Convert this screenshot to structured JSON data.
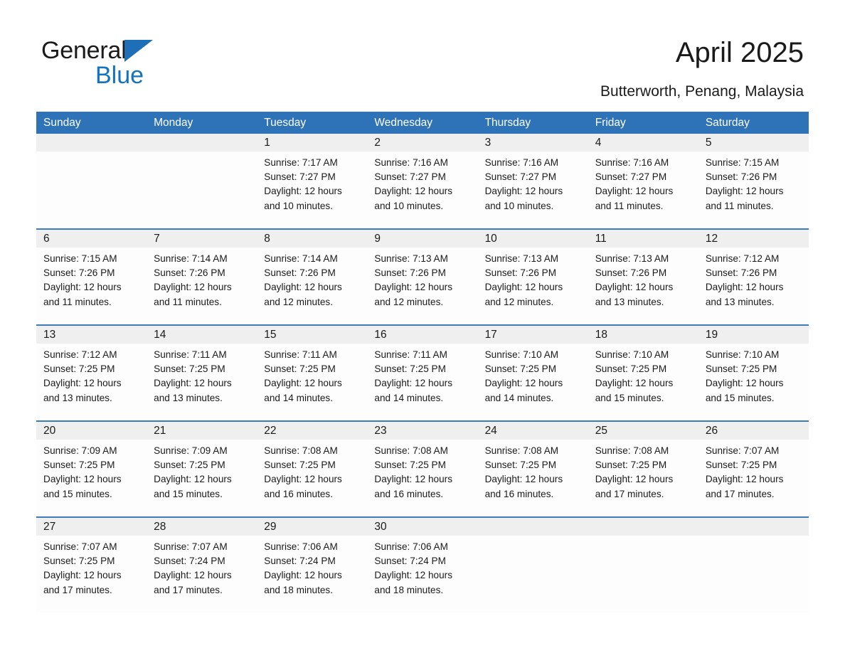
{
  "brand": {
    "name_part1": "General",
    "name_part2": "Blue",
    "triangle_color": "#1e6fb8",
    "blue_color": "#1273c4"
  },
  "header": {
    "title": "April 2025",
    "subtitle": "Butterworth, Penang, Malaysia"
  },
  "colors": {
    "header_blue": "#2e73b8",
    "row_divider_blue": "#3d7cb5",
    "date_strip_gray": "#efefef",
    "cell_background": "#fdfdfd",
    "text": "#1a1a1a"
  },
  "calendar": {
    "weekday_headers": [
      "Sunday",
      "Monday",
      "Tuesday",
      "Wednesday",
      "Thursday",
      "Friday",
      "Saturday"
    ],
    "weeks": [
      {
        "days": [
          {
            "date": "",
            "empty": true
          },
          {
            "date": "",
            "empty": true
          },
          {
            "date": "1",
            "sunrise": "Sunrise: 7:17 AM",
            "sunset": "Sunset: 7:27 PM",
            "daylight_1": "Daylight: 12 hours",
            "daylight_2": "and 10 minutes."
          },
          {
            "date": "2",
            "sunrise": "Sunrise: 7:16 AM",
            "sunset": "Sunset: 7:27 PM",
            "daylight_1": "Daylight: 12 hours",
            "daylight_2": "and 10 minutes."
          },
          {
            "date": "3",
            "sunrise": "Sunrise: 7:16 AM",
            "sunset": "Sunset: 7:27 PM",
            "daylight_1": "Daylight: 12 hours",
            "daylight_2": "and 10 minutes."
          },
          {
            "date": "4",
            "sunrise": "Sunrise: 7:16 AM",
            "sunset": "Sunset: 7:27 PM",
            "daylight_1": "Daylight: 12 hours",
            "daylight_2": "and 11 minutes."
          },
          {
            "date": "5",
            "sunrise": "Sunrise: 7:15 AM",
            "sunset": "Sunset: 7:26 PM",
            "daylight_1": "Daylight: 12 hours",
            "daylight_2": "and 11 minutes."
          }
        ]
      },
      {
        "days": [
          {
            "date": "6",
            "sunrise": "Sunrise: 7:15 AM",
            "sunset": "Sunset: 7:26 PM",
            "daylight_1": "Daylight: 12 hours",
            "daylight_2": "and 11 minutes."
          },
          {
            "date": "7",
            "sunrise": "Sunrise: 7:14 AM",
            "sunset": "Sunset: 7:26 PM",
            "daylight_1": "Daylight: 12 hours",
            "daylight_2": "and 11 minutes."
          },
          {
            "date": "8",
            "sunrise": "Sunrise: 7:14 AM",
            "sunset": "Sunset: 7:26 PM",
            "daylight_1": "Daylight: 12 hours",
            "daylight_2": "and 12 minutes."
          },
          {
            "date": "9",
            "sunrise": "Sunrise: 7:13 AM",
            "sunset": "Sunset: 7:26 PM",
            "daylight_1": "Daylight: 12 hours",
            "daylight_2": "and 12 minutes."
          },
          {
            "date": "10",
            "sunrise": "Sunrise: 7:13 AM",
            "sunset": "Sunset: 7:26 PM",
            "daylight_1": "Daylight: 12 hours",
            "daylight_2": "and 12 minutes."
          },
          {
            "date": "11",
            "sunrise": "Sunrise: 7:13 AM",
            "sunset": "Sunset: 7:26 PM",
            "daylight_1": "Daylight: 12 hours",
            "daylight_2": "and 13 minutes."
          },
          {
            "date": "12",
            "sunrise": "Sunrise: 7:12 AM",
            "sunset": "Sunset: 7:26 PM",
            "daylight_1": "Daylight: 12 hours",
            "daylight_2": "and 13 minutes."
          }
        ]
      },
      {
        "days": [
          {
            "date": "13",
            "sunrise": "Sunrise: 7:12 AM",
            "sunset": "Sunset: 7:25 PM",
            "daylight_1": "Daylight: 12 hours",
            "daylight_2": "and 13 minutes."
          },
          {
            "date": "14",
            "sunrise": "Sunrise: 7:11 AM",
            "sunset": "Sunset: 7:25 PM",
            "daylight_1": "Daylight: 12 hours",
            "daylight_2": "and 13 minutes."
          },
          {
            "date": "15",
            "sunrise": "Sunrise: 7:11 AM",
            "sunset": "Sunset: 7:25 PM",
            "daylight_1": "Daylight: 12 hours",
            "daylight_2": "and 14 minutes."
          },
          {
            "date": "16",
            "sunrise": "Sunrise: 7:11 AM",
            "sunset": "Sunset: 7:25 PM",
            "daylight_1": "Daylight: 12 hours",
            "daylight_2": "and 14 minutes."
          },
          {
            "date": "17",
            "sunrise": "Sunrise: 7:10 AM",
            "sunset": "Sunset: 7:25 PM",
            "daylight_1": "Daylight: 12 hours",
            "daylight_2": "and 14 minutes."
          },
          {
            "date": "18",
            "sunrise": "Sunrise: 7:10 AM",
            "sunset": "Sunset: 7:25 PM",
            "daylight_1": "Daylight: 12 hours",
            "daylight_2": "and 15 minutes."
          },
          {
            "date": "19",
            "sunrise": "Sunrise: 7:10 AM",
            "sunset": "Sunset: 7:25 PM",
            "daylight_1": "Daylight: 12 hours",
            "daylight_2": "and 15 minutes."
          }
        ]
      },
      {
        "days": [
          {
            "date": "20",
            "sunrise": "Sunrise: 7:09 AM",
            "sunset": "Sunset: 7:25 PM",
            "daylight_1": "Daylight: 12 hours",
            "daylight_2": "and 15 minutes."
          },
          {
            "date": "21",
            "sunrise": "Sunrise: 7:09 AM",
            "sunset": "Sunset: 7:25 PM",
            "daylight_1": "Daylight: 12 hours",
            "daylight_2": "and 15 minutes."
          },
          {
            "date": "22",
            "sunrise": "Sunrise: 7:08 AM",
            "sunset": "Sunset: 7:25 PM",
            "daylight_1": "Daylight: 12 hours",
            "daylight_2": "and 16 minutes."
          },
          {
            "date": "23",
            "sunrise": "Sunrise: 7:08 AM",
            "sunset": "Sunset: 7:25 PM",
            "daylight_1": "Daylight: 12 hours",
            "daylight_2": "and 16 minutes."
          },
          {
            "date": "24",
            "sunrise": "Sunrise: 7:08 AM",
            "sunset": "Sunset: 7:25 PM",
            "daylight_1": "Daylight: 12 hours",
            "daylight_2": "and 16 minutes."
          },
          {
            "date": "25",
            "sunrise": "Sunrise: 7:08 AM",
            "sunset": "Sunset: 7:25 PM",
            "daylight_1": "Daylight: 12 hours",
            "daylight_2": "and 17 minutes."
          },
          {
            "date": "26",
            "sunrise": "Sunrise: 7:07 AM",
            "sunset": "Sunset: 7:25 PM",
            "daylight_1": "Daylight: 12 hours",
            "daylight_2": "and 17 minutes."
          }
        ]
      },
      {
        "days": [
          {
            "date": "27",
            "sunrise": "Sunrise: 7:07 AM",
            "sunset": "Sunset: 7:25 PM",
            "daylight_1": "Daylight: 12 hours",
            "daylight_2": "and 17 minutes."
          },
          {
            "date": "28",
            "sunrise": "Sunrise: 7:07 AM",
            "sunset": "Sunset: 7:24 PM",
            "daylight_1": "Daylight: 12 hours",
            "daylight_2": "and 17 minutes."
          },
          {
            "date": "29",
            "sunrise": "Sunrise: 7:06 AM",
            "sunset": "Sunset: 7:24 PM",
            "daylight_1": "Daylight: 12 hours",
            "daylight_2": "and 18 minutes."
          },
          {
            "date": "30",
            "sunrise": "Sunrise: 7:06 AM",
            "sunset": "Sunset: 7:24 PM",
            "daylight_1": "Daylight: 12 hours",
            "daylight_2": "and 18 minutes."
          },
          {
            "date": "",
            "empty": true
          },
          {
            "date": "",
            "empty": true
          },
          {
            "date": "",
            "empty": true
          }
        ]
      }
    ]
  }
}
